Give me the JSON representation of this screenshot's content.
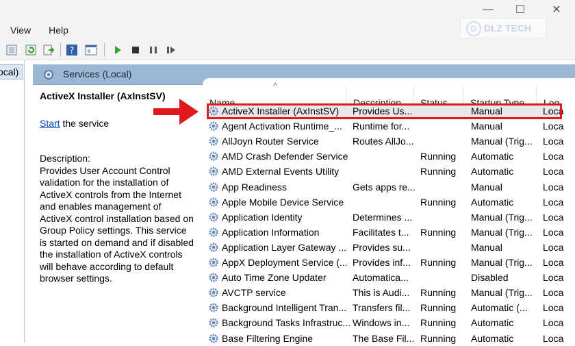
{
  "window": {
    "controls": [
      "—",
      "☐",
      "✕"
    ]
  },
  "menu": {
    "items": [
      "View",
      "Help"
    ]
  },
  "watermark": {
    "text": "DLZ TECH"
  },
  "tree": {
    "item": "ocal)"
  },
  "header": {
    "title": "Services (Local)"
  },
  "details": {
    "service_name": "ActiveX Installer (AxInstSV)",
    "start_link": "Start",
    "start_suffix": " the service",
    "description_label": "Description:",
    "description_text": "Provides User Account Control validation for the installation of ActiveX controls from the Internet and enables management of ActiveX control installation based on Group Policy settings. This service is started on demand and if disabled the installation of ActiveX controls will behave according to default browser settings."
  },
  "columns": [
    "Name",
    "Description",
    "Status",
    "Startup Type",
    "Log"
  ],
  "rows": [
    {
      "name": "ActiveX Installer (AxInstSV)",
      "desc": "Provides Us...",
      "status": "",
      "startup": "Manual",
      "log": "Loca"
    },
    {
      "name": "Agent Activation Runtime_...",
      "desc": "Runtime for...",
      "status": "",
      "startup": "Manual",
      "log": "Loca"
    },
    {
      "name": "AllJoyn Router Service",
      "desc": "Routes AllJo...",
      "status": "",
      "startup": "Manual (Trig...",
      "log": "Loca"
    },
    {
      "name": "AMD Crash Defender Service",
      "desc": "",
      "status": "Running",
      "startup": "Automatic",
      "log": "Loca"
    },
    {
      "name": "AMD External Events Utility",
      "desc": "",
      "status": "Running",
      "startup": "Automatic",
      "log": "Loca"
    },
    {
      "name": "App Readiness",
      "desc": "Gets apps re...",
      "status": "",
      "startup": "Manual",
      "log": "Loca"
    },
    {
      "name": "Apple Mobile Device Service",
      "desc": "",
      "status": "Running",
      "startup": "Automatic",
      "log": "Loca"
    },
    {
      "name": "Application Identity",
      "desc": "Determines ...",
      "status": "",
      "startup": "Manual (Trig...",
      "log": "Loca"
    },
    {
      "name": "Application Information",
      "desc": "Facilitates t...",
      "status": "Running",
      "startup": "Manual (Trig...",
      "log": "Loca"
    },
    {
      "name": "Application Layer Gateway ...",
      "desc": "Provides su...",
      "status": "",
      "startup": "Manual",
      "log": "Loca"
    },
    {
      "name": "AppX Deployment Service (...",
      "desc": "Provides inf...",
      "status": "Running",
      "startup": "Manual (Trig...",
      "log": "Loca"
    },
    {
      "name": "Auto Time Zone Updater",
      "desc": "Automatica...",
      "status": "",
      "startup": "Disabled",
      "log": "Loca"
    },
    {
      "name": "AVCTP service",
      "desc": "This is Audi...",
      "status": "Running",
      "startup": "Manual (Trig...",
      "log": "Loca"
    },
    {
      "name": "Background Intelligent Tran...",
      "desc": "Transfers fil...",
      "status": "Running",
      "startup": "Automatic (...",
      "log": "Loca"
    },
    {
      "name": "Background Tasks Infrastruc...",
      "desc": "Windows in...",
      "status": "Running",
      "startup": "Automatic",
      "log": "Loca"
    },
    {
      "name": "Base Filtering Engine",
      "desc": "The Base Fil...",
      "status": "Running",
      "startup": "Automatic",
      "log": "Loca"
    }
  ],
  "colors": {
    "highlight": "#e0191f",
    "header_bg": "#9cb7d6",
    "link": "#0645ad"
  }
}
